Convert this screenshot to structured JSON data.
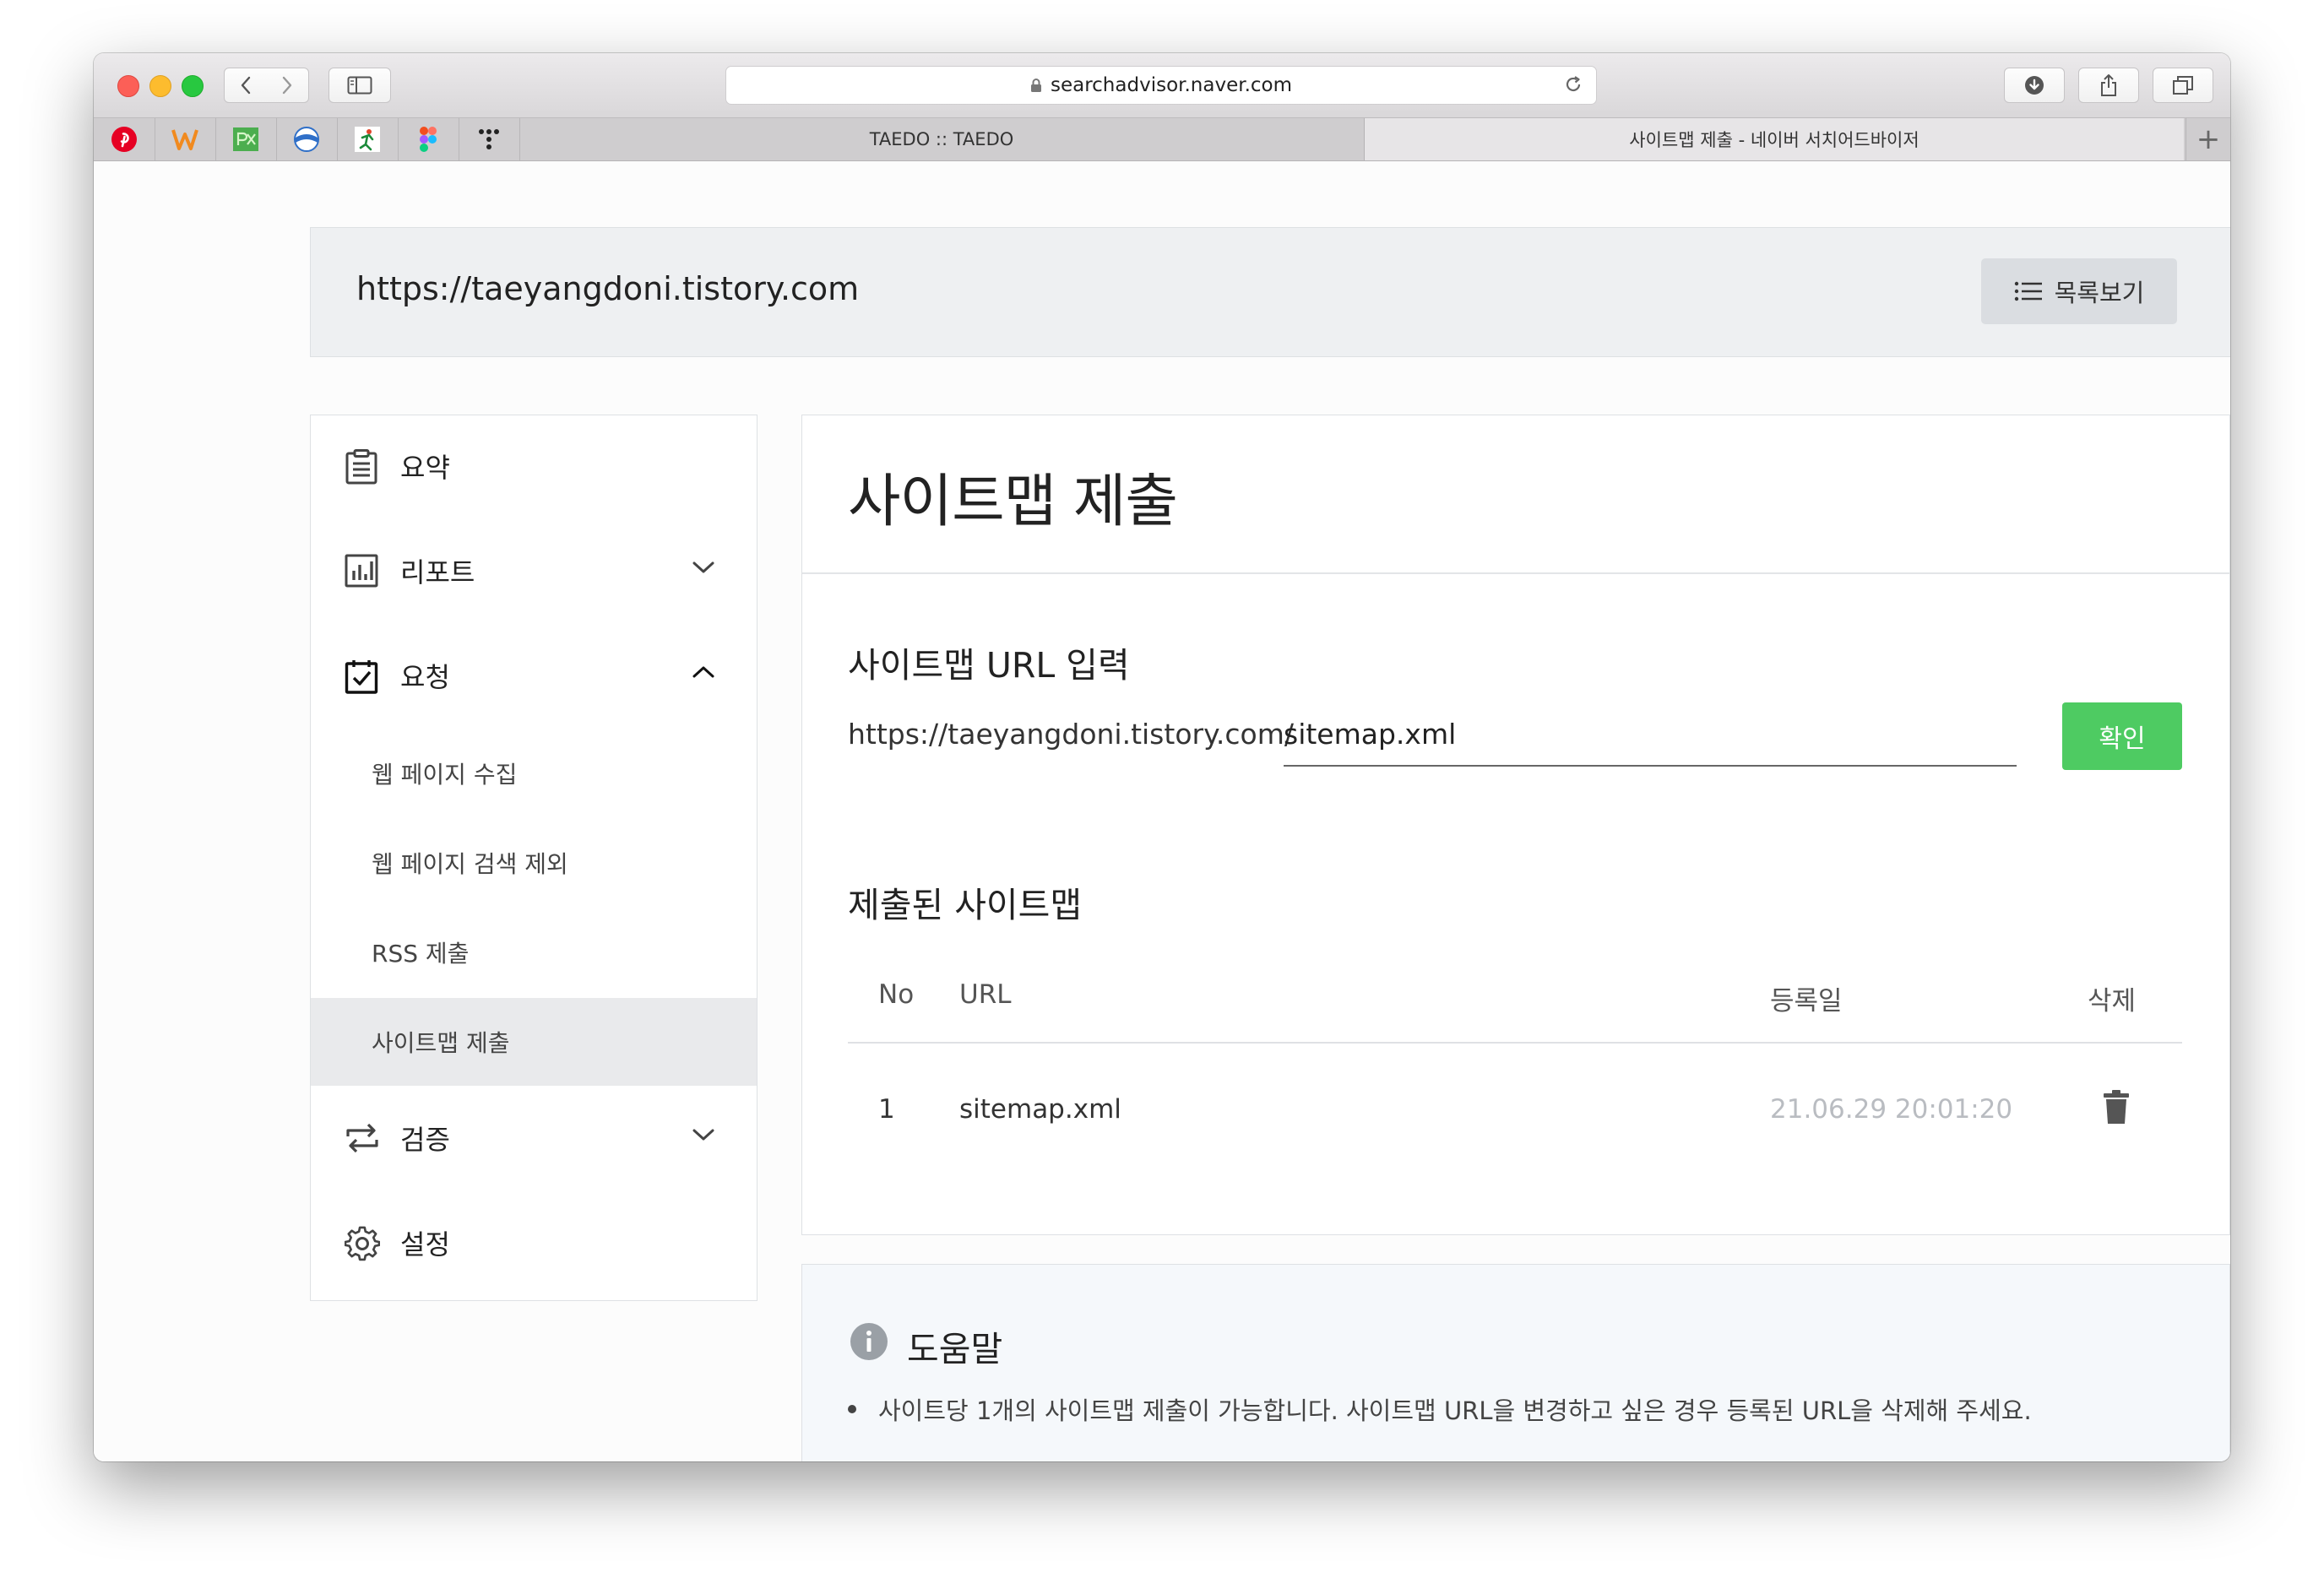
{
  "browser": {
    "address": "searchadvisor.naver.com",
    "tabs": [
      {
        "label": "TAEDO :: TAEDO"
      },
      {
        "label": "사이트맵 제출 - 네이버 서치어드바이저"
      }
    ],
    "favorites": [
      "pinterest-icon",
      "w-icon",
      "px-icon",
      "globe-icon",
      "runner-icon",
      "figma-icon",
      "dots-icon"
    ],
    "new_tab_label": "+"
  },
  "header": {
    "site_url": "https://taeyangdoni.tistory.com",
    "list_button_label": "목록보기"
  },
  "sidebar": {
    "items": [
      {
        "label": "요약"
      },
      {
        "label": "리포트"
      },
      {
        "label": "요청"
      },
      {
        "label": "검증"
      },
      {
        "label": "설정"
      }
    ],
    "subitems": [
      {
        "label": "웹 페이지 수집"
      },
      {
        "label": "웹 페이지 검색 제외"
      },
      {
        "label": "RSS 제출"
      },
      {
        "label": "사이트맵 제출",
        "active": true
      }
    ]
  },
  "main": {
    "title": "사이트맵 제출",
    "url_section_title": "사이트맵 URL 입력",
    "url_prefix": "https://taeyangdoni.tistory.com/",
    "input_value": "sitemap.xml",
    "confirm_label": "확인",
    "submitted_title": "제출된 사이트맵",
    "table": {
      "headers": [
        "No",
        "URL",
        "등록일",
        "삭제"
      ],
      "rows": [
        {
          "no": "1",
          "url": "sitemap.xml",
          "date": "21.06.29 20:01:20"
        }
      ]
    }
  },
  "help": {
    "title": "도움말",
    "text": "사이트당 1개의 사이트맵 제출이 가능합니다. 사이트맵 URL을 변경하고 싶은 경우 등록된 URL을 삭제해 주세요."
  },
  "colors": {
    "confirm_button": "#4ecb62",
    "active_nav_bg": "#e9eaec",
    "date_text": "#b9bcc1"
  }
}
